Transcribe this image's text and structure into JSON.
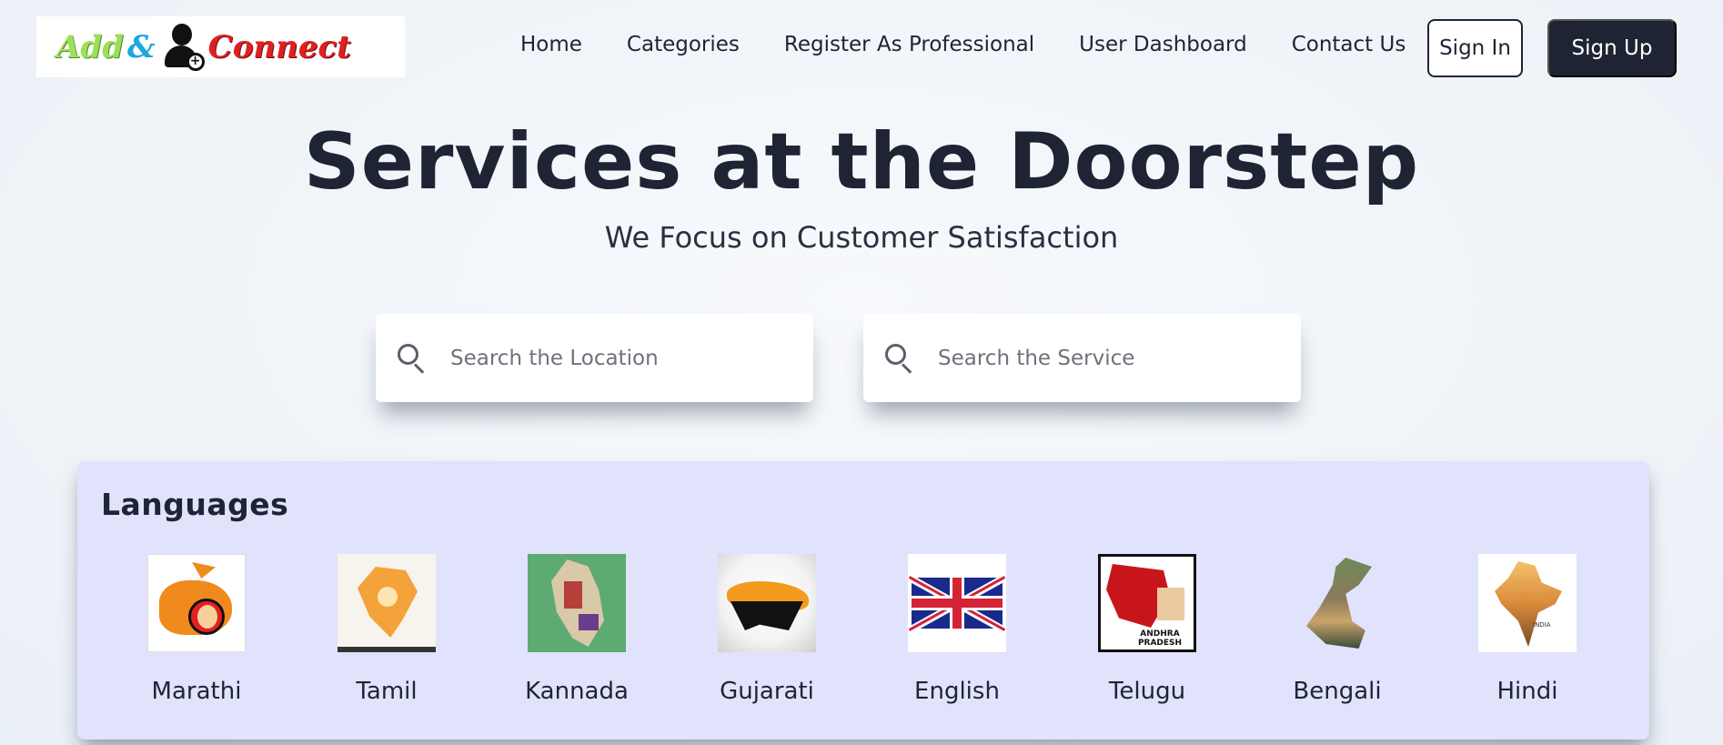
{
  "brand": {
    "logo_word1": "Add",
    "logo_amp": "&",
    "logo_word2": "Connect",
    "logo_plus": "+"
  },
  "nav": {
    "items": [
      "Home",
      "Categories",
      "Register As Professional",
      "User Dashboard",
      "Contact Us"
    ],
    "sign_in": "Sign In",
    "sign_up": "Sign Up"
  },
  "hero": {
    "title": "Services at the Doorstep",
    "subtitle": "We Focus on Customer Satisfaction"
  },
  "search": {
    "location_placeholder": "Search the Location",
    "service_placeholder": "Search the Service",
    "location_value": "",
    "service_value": ""
  },
  "languages": {
    "title": "Languages",
    "items": [
      {
        "name": "Marathi",
        "image_caption": ""
      },
      {
        "name": "Tamil",
        "image_caption": ""
      },
      {
        "name": "Kannada",
        "image_caption": ""
      },
      {
        "name": "Gujarati",
        "image_caption": ""
      },
      {
        "name": "English",
        "image_caption": ""
      },
      {
        "name": "Telugu",
        "image_caption": "ANDHRA PRADESH"
      },
      {
        "name": "Bengali",
        "image_caption": ""
      },
      {
        "name": "Hindi",
        "image_caption": "INDIA"
      }
    ]
  },
  "colors": {
    "primary_dark": "#1e2433",
    "panel_bg": "#e0e3fb",
    "logo_green": "#9be05a",
    "logo_blue": "#1ba7e0",
    "logo_red": "#e02020"
  },
  "icons": {
    "search": "search-icon",
    "logo_person": "person-add-icon"
  }
}
